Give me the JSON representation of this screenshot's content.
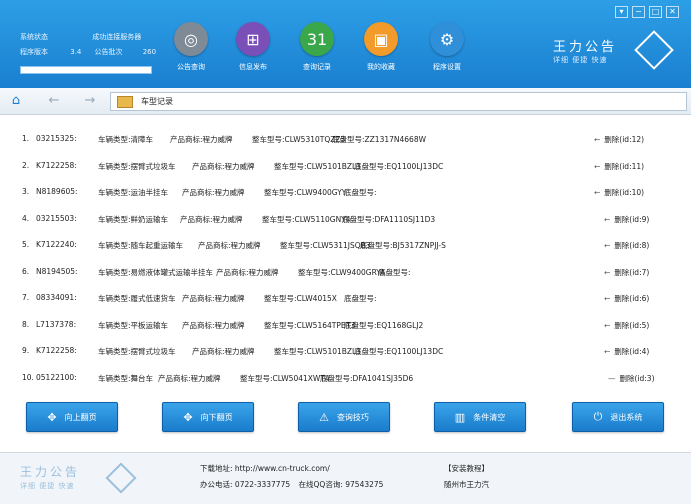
{
  "header": {
    "status_label": "系统状态",
    "status_value": "成功连接服务器",
    "version_label": "程序版本",
    "version_value": "3.4",
    "batch_label": "公告批次",
    "batch_value": "260",
    "nav": [
      {
        "label": "公告查询",
        "icon": "radar-icon",
        "color": "#7f8a97"
      },
      {
        "label": "信息发布",
        "icon": "cart-icon",
        "color": "#7a4fb8"
      },
      {
        "label": "查询记录",
        "icon": "calendar-icon",
        "color": "#3aa84a"
      },
      {
        "label": "我的收藏",
        "icon": "folder-icon",
        "color": "#f29a2a"
      },
      {
        "label": "程序设置",
        "icon": "gear-icon",
        "color": "#2f8fd9"
      }
    ],
    "brand": "王力公告",
    "brand_sub": "详细 便捷 快速"
  },
  "addressbar": {
    "path": "车型记录"
  },
  "records": [
    {
      "idx": "1.",
      "code": "03215325:",
      "type": "车辆类型:清障车",
      "brand": "产品商标:程力威牌",
      "model": "整车型号:CLW5310TQZZ3",
      "chassis": "底盘型号:ZZ1317N4668W",
      "del": "删除(id:12)"
    },
    {
      "idx": "2.",
      "code": "K7122258:",
      "type": "车辆类型:摆臂式垃圾车",
      "brand": "产品商标:程力威牌",
      "model": "整车型号:CLW5101BZL3",
      "chassis": "底盘型号:EQ1100LJ13DC",
      "del": "删除(id:11)"
    },
    {
      "idx": "3.",
      "code": "N8189605:",
      "type": "车辆类型:运油半挂车",
      "brand": "产品商标:程力威牌",
      "model": "整车型号:CLW9400GYY",
      "chassis": "底盘型号:",
      "del": "删除(id:10)"
    },
    {
      "idx": "4.",
      "code": "03215503:",
      "type": "车辆类型:鲜奶运输车",
      "brand": "产品商标:程力威牌",
      "model": "整车型号:CLW5110GNY4",
      "chassis": "底盘型号:DFA1110SJ11D3",
      "del": "删除(id:9)"
    },
    {
      "idx": "5.",
      "code": "K7122240:",
      "type": "车辆类型:随车起重运输车",
      "brand": "产品商标:程力威牌",
      "model": "整车型号:CLW5311JSQB3",
      "chassis": "底盘型号:BJ5317ZNPJJ-S",
      "del": "删除(id:8)"
    },
    {
      "idx": "6.",
      "code": "N8194505:",
      "type": "车辆类型:易燃液体罐式运输半挂车",
      "brand": "产品商标:程力威牌",
      "model": "整车型号:CLW9400GRYA",
      "chassis": "底盘型号:",
      "del": "删除(id:7)"
    },
    {
      "idx": "7.",
      "code": "08334091:",
      "type": "车辆类型:履式低速货车",
      "brand": "产品商标:程力威牌",
      "model": "整车型号:CLW4015X",
      "chassis": "底盘型号:",
      "del": "删除(id:6)"
    },
    {
      "idx": "8.",
      "code": "L7137378:",
      "type": "车辆类型:平板运输车",
      "brand": "产品商标:程力威牌",
      "model": "整车型号:CLW5164TPBT3",
      "chassis": "底盘型号:EQ1168GLJ2",
      "del": "删除(id:5)"
    },
    {
      "idx": "9.",
      "code": "K7122258:",
      "type": "车辆类型:摆臂式垃圾车",
      "brand": "产品商标:程力威牌",
      "model": "整车型号:CLW5101BZL3",
      "chassis": "底盘型号:EQ1100LJ13DC",
      "del": "删除(id:4)"
    },
    {
      "idx": "10.",
      "code": "05122100:",
      "type": "车辆类型:舞台车",
      "brand": "产品商标:程力威牌",
      "model": "整车型号:CLW5041XWT4",
      "chassis": "底盘型号:DFA1041SJ35D6",
      "del": "删除(id:3)"
    }
  ],
  "buttons": [
    {
      "label": "向上翻页",
      "icon": "move-icon"
    },
    {
      "label": "向下翻页",
      "icon": "move-icon"
    },
    {
      "label": "查询技巧",
      "icon": "warning-icon"
    },
    {
      "label": "条件清空",
      "icon": "trash-icon"
    },
    {
      "label": "退出系统",
      "icon": "power-icon"
    }
  ],
  "footer": {
    "brand": "王力公告",
    "brand_sub": "详细 便捷 快速",
    "download_label": "下载地址:",
    "download_url": "http://www.cn-truck.com/",
    "phone_label": "办公电话:",
    "phone": "0722-3337775",
    "qq_label": "在线QQ咨询:",
    "qq": "97543275",
    "install_label": "【安装教程】",
    "company": "随州市王力汽"
  }
}
